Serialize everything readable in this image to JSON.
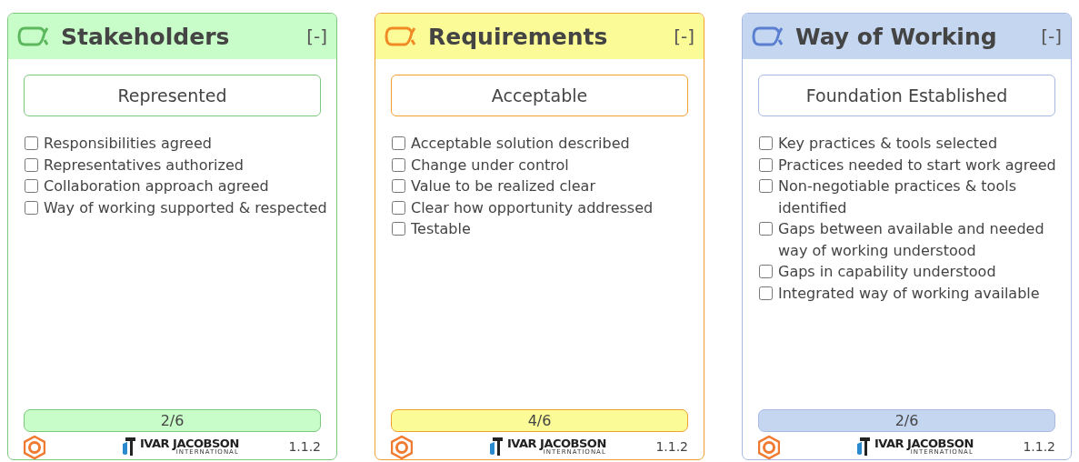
{
  "cards": [
    {
      "title": "Stakeholders",
      "toggle": "[-]",
      "color": "#c8fcc8",
      "state": "Represented",
      "progress": "2/6",
      "logo_name": "IVAR JACOBSON",
      "logo_sub": "INTERNATIONAL",
      "version": "1.1.2",
      "checklist": [
        {
          "label": "Responsibilities agreed",
          "checked": false
        },
        {
          "label": "Representatives authorized",
          "checked": false
        },
        {
          "label": "Collaboration approach agreed",
          "checked": false
        },
        {
          "label": "Way of working supported & respected",
          "checked": false
        }
      ]
    },
    {
      "title": "Requirements",
      "toggle": "[-]",
      "color": "#fbfb98",
      "state": "Acceptable",
      "progress": "4/6",
      "logo_name": "IVAR JACOBSON",
      "logo_sub": "INTERNATIONAL",
      "version": "1.1.2",
      "checklist": [
        {
          "label": "Acceptable solution described",
          "checked": false
        },
        {
          "label": "Change under control",
          "checked": false
        },
        {
          "label": "Value to be realized clear",
          "checked": false
        },
        {
          "label": "Clear how opportunity addressed",
          "checked": false
        },
        {
          "label": "Testable",
          "checked": false
        }
      ]
    },
    {
      "title": "Way of Working",
      "toggle": "[-]",
      "color": "#c5d7f0",
      "state": "Foundation Established",
      "progress": "2/6",
      "logo_name": "IVAR JACOBSON",
      "logo_sub": "INTERNATIONAL",
      "version": "1.1.2",
      "checklist": [
        {
          "label": "Key practices & tools selected",
          "checked": false
        },
        {
          "label": "Practices needed to start work agreed",
          "checked": false
        },
        {
          "label": "Non-negotiable practices & tools identified",
          "checked": false
        },
        {
          "label": "Gaps between available and needed way of working understood",
          "checked": false
        },
        {
          "label": "Gaps in capability understood",
          "checked": false
        },
        {
          "label": "Integrated way of working available",
          "checked": false
        }
      ]
    }
  ]
}
